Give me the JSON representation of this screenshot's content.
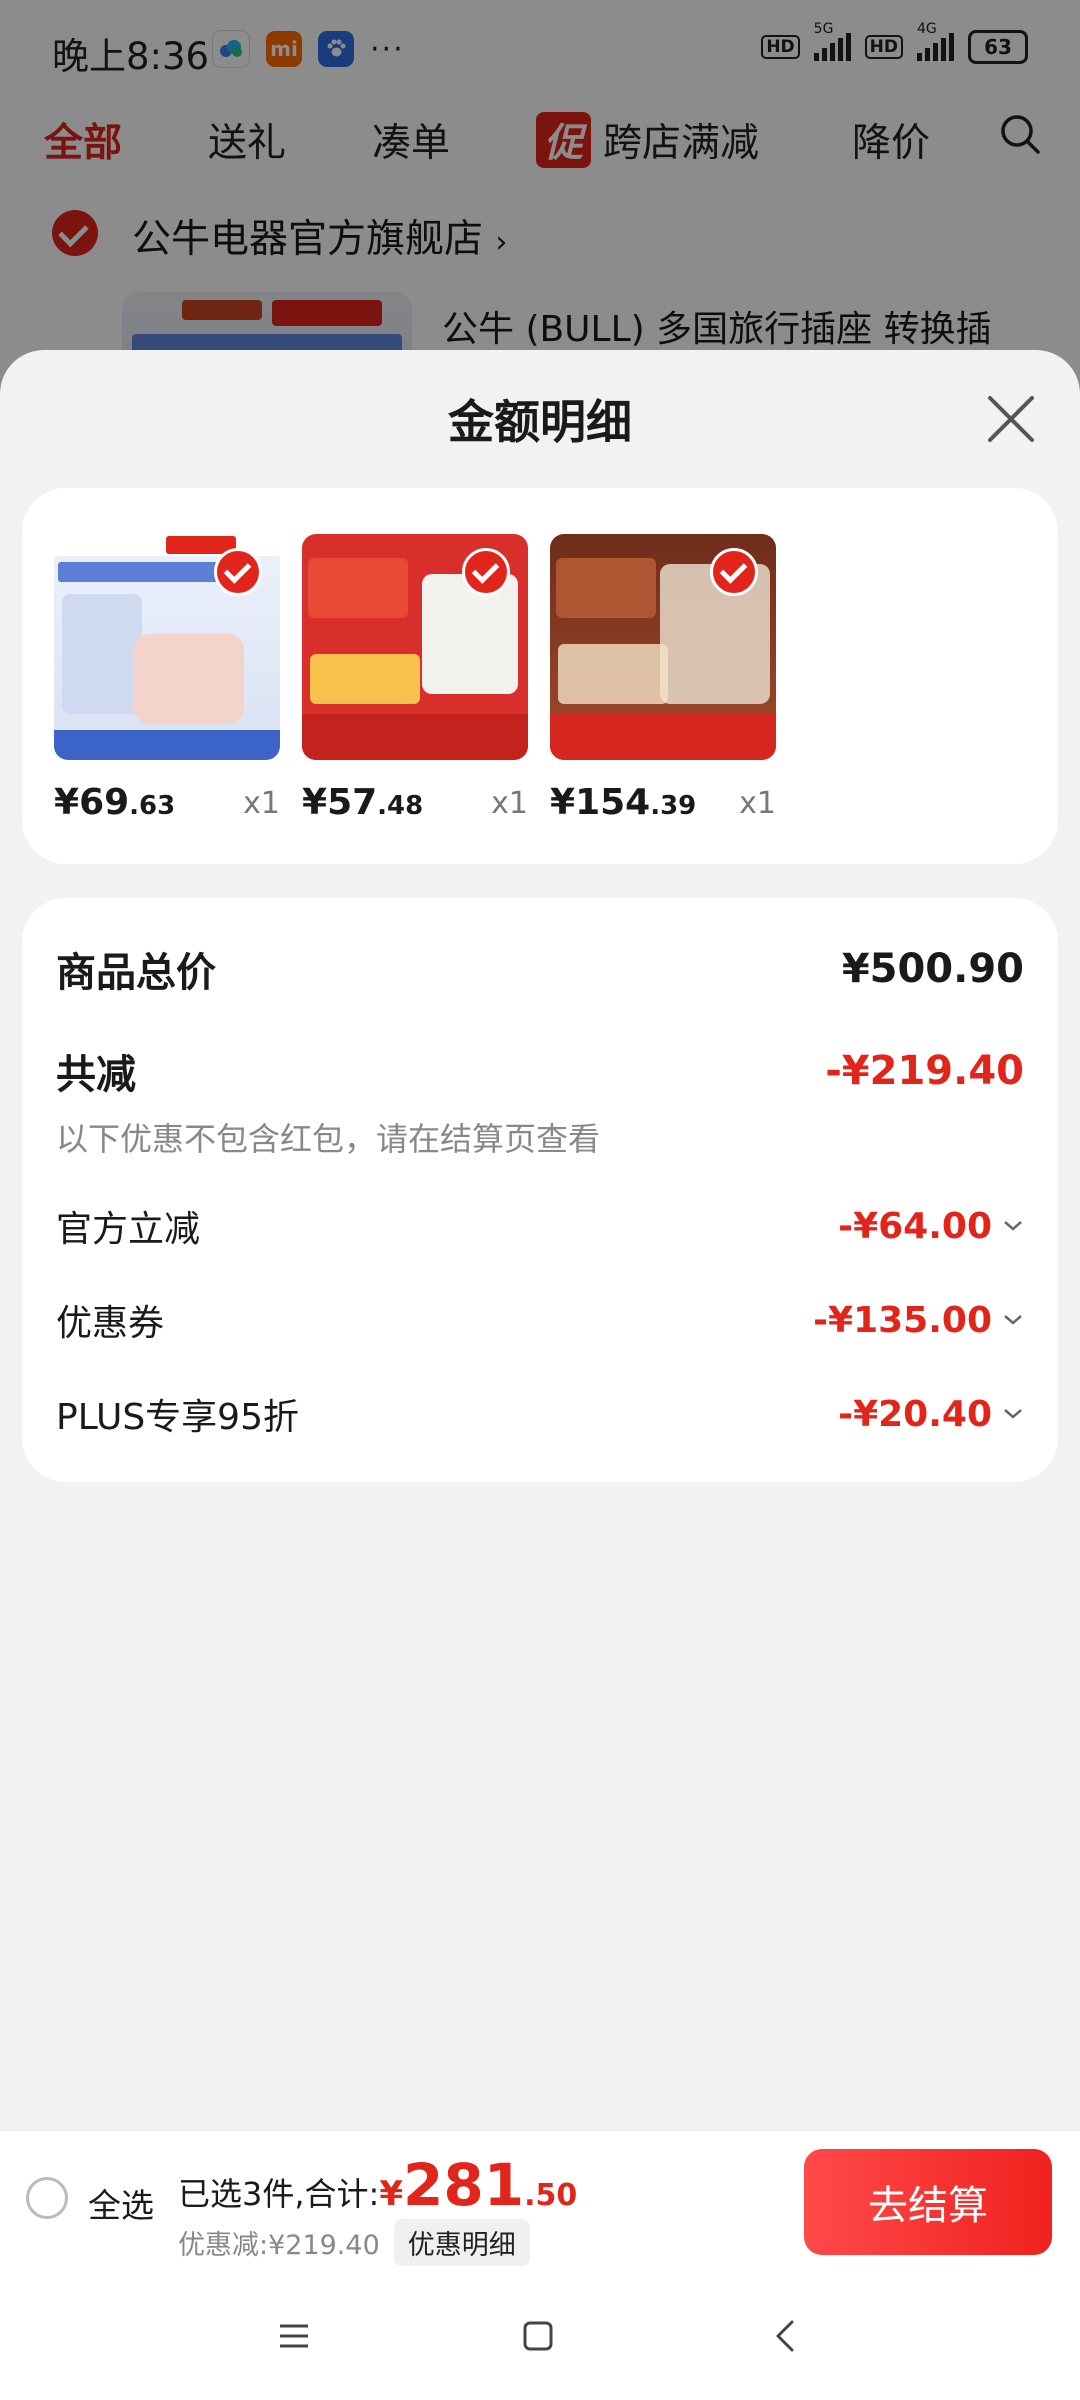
{
  "status_bar": {
    "time": "晚上8:36",
    "hd1": "HD",
    "net1": "5G",
    "hd2": "HD",
    "net2": "4G",
    "battery": "63"
  },
  "tabs": [
    {
      "label": "全部"
    },
    {
      "label": "送礼"
    },
    {
      "label": "凑单"
    },
    {
      "label": "跨店满减",
      "badge": "促"
    },
    {
      "label": "降价"
    }
  ],
  "background": {
    "store_name": "公牛电器官方旗舰店",
    "store_arrow": "›",
    "product_title": "公牛 (BULL) 多国旅行插座 转换插"
  },
  "sheet": {
    "title": "金额明细",
    "items": [
      {
        "currency": "¥",
        "price_int": "69",
        "price_dec": ".63",
        "qty": "x1",
        "thumb_color": "#e9eef8",
        "accent": "#f6d8d2"
      },
      {
        "currency": "¥",
        "price_int": "57",
        "price_dec": ".48",
        "qty": "x1",
        "thumb_color": "#d92f2b",
        "accent": "#f0f0ee"
      },
      {
        "currency": "¥",
        "price_int": "154",
        "price_dec": ".39",
        "qty": "x1",
        "thumb_color": "#8a3b22",
        "accent": "#d5271f"
      }
    ],
    "summary": {
      "total_label": "商品总价",
      "total_value": "¥500.90",
      "reduce_label": "共减",
      "reduce_value": "-¥219.40",
      "note": "以下优惠不包含红包，请在结算页查看",
      "lines": [
        {
          "label": "官方立减",
          "value": "-¥64.00"
        },
        {
          "label": "优惠券",
          "value": "-¥135.00"
        },
        {
          "label": "PLUS专享95折",
          "value": "-¥20.40"
        }
      ]
    }
  },
  "checkout": {
    "select_all": "全选",
    "selected_text": "已选3件,合计:",
    "currency": "¥",
    "total_int": "281",
    "total_dec": ".50",
    "discount_text": "优惠减:¥219.40",
    "detail_chip": "优惠明细",
    "pay_button": "去结算"
  },
  "colors": {
    "brand_red": "#e1251b",
    "page_bg": "#f2f2f3"
  }
}
